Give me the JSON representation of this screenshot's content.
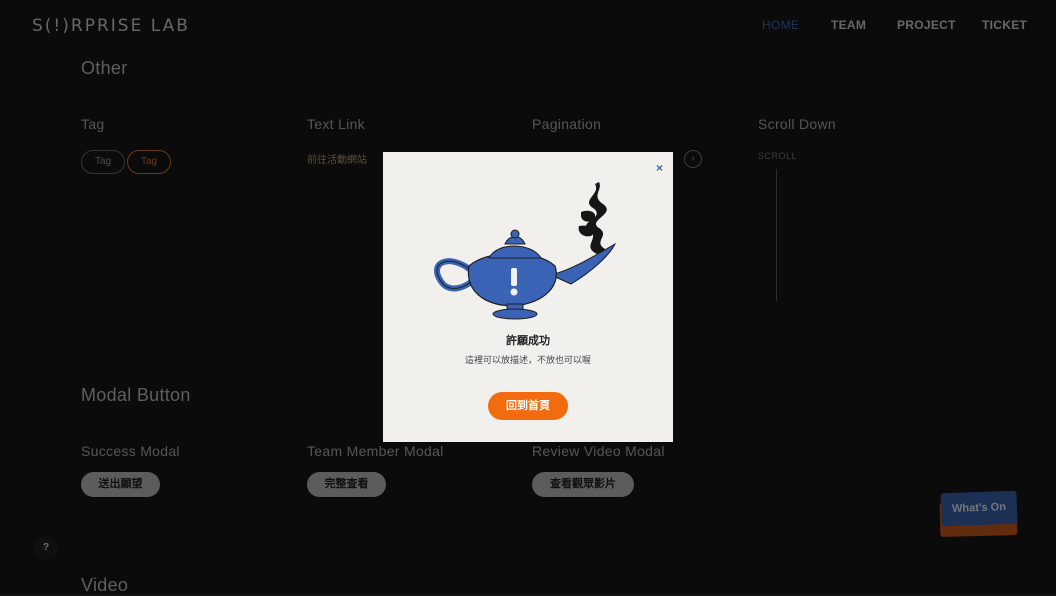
{
  "nav": {
    "logo_prefix": "S",
    "logo_bang": "(!)",
    "logo_suffix": "RPRISE LAB",
    "items": [
      {
        "label": "HOME",
        "active": true
      },
      {
        "label": "TEAM",
        "active": false
      },
      {
        "label": "PROJECT",
        "active": false
      },
      {
        "label": "TICKET",
        "active": false
      }
    ]
  },
  "sections": {
    "other": {
      "title": "Other",
      "tag": {
        "title": "Tag",
        "items": [
          "Tag",
          "Tag"
        ]
      },
      "text_link": {
        "title": "Text Link",
        "link": "前往活動網站"
      },
      "pagination": {
        "title": "Pagination",
        "next": "›"
      },
      "scroll": {
        "title": "Scroll Down",
        "label": "SCROLL"
      }
    },
    "modal_button": {
      "title": "Modal Button",
      "success": {
        "title": "Success Modal",
        "button": "送出願望"
      },
      "team": {
        "title": "Team Member Modal",
        "button": "完整查看"
      },
      "review": {
        "title": "Review Video Modal",
        "button": "查看觀眾影片"
      }
    },
    "video": {
      "title": "Video"
    }
  },
  "help": {
    "label": "?"
  },
  "whats_on": {
    "label": "What's On"
  },
  "modal": {
    "close": "×",
    "title": "許願成功",
    "description": "這裡可以放描述，不放也可以喔",
    "button": "回到首頁"
  },
  "colors": {
    "accent_blue": "#3b69b5",
    "accent_orange": "#f26b0f",
    "modal_bg": "#f2f0ed"
  }
}
